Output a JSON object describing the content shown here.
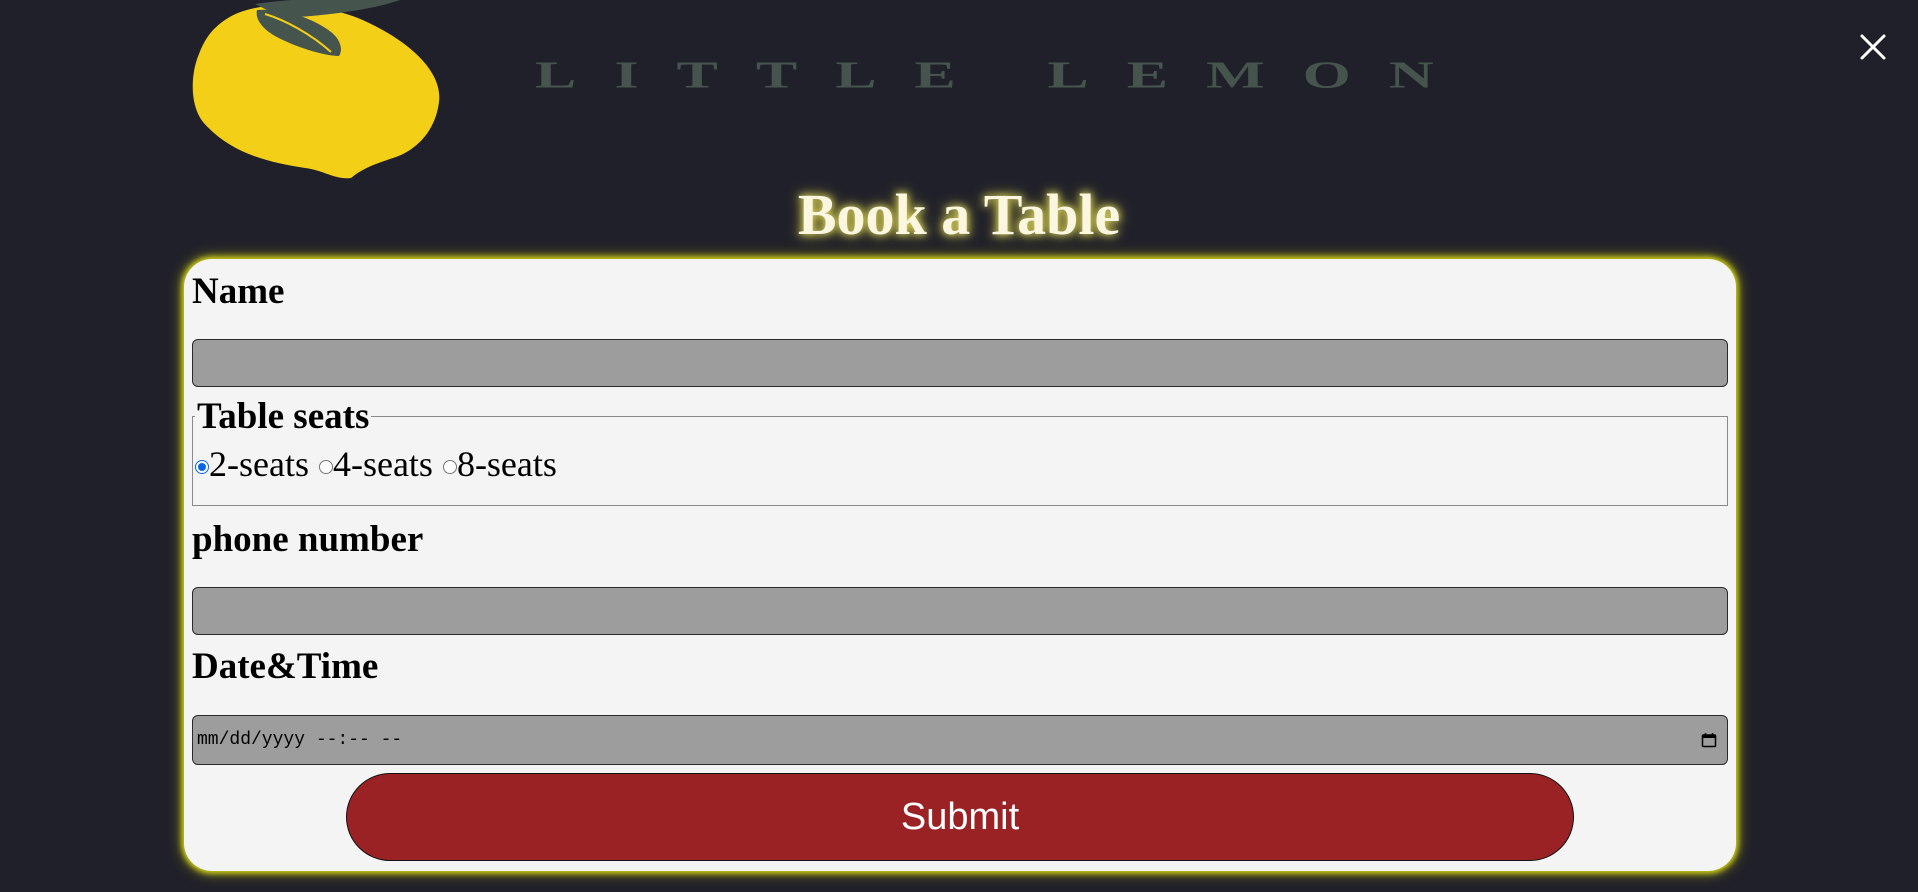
{
  "header": {
    "brand_name": "LITTLE LEMON",
    "logo_icon": "lemon-icon",
    "close_icon": "close-icon"
  },
  "title": "Book a Table",
  "form": {
    "name": {
      "label": "Name",
      "value": "",
      "placeholder": ""
    },
    "table_seats": {
      "legend": "Table seats",
      "options": [
        {
          "label": "2-seats",
          "checked": true
        },
        {
          "label": "4-seats",
          "checked": false
        },
        {
          "label": "8-seats",
          "checked": false
        }
      ]
    },
    "phone": {
      "label": "phone number",
      "value": "",
      "placeholder": ""
    },
    "datetime": {
      "label": "Date&Time",
      "placeholder": "mm/dd/yyyy --:-- --",
      "icon": "calendar-icon"
    },
    "submit_label": "Submit"
  },
  "colors": {
    "background": "#20202a",
    "lemon": "#f4cf17",
    "leaf": "#45544c",
    "card": "#f4f4f4",
    "input": "#9d9d9d",
    "submit": "#9a2224",
    "glow": "#d6d61a",
    "radio_checked": "#0b66e4"
  }
}
